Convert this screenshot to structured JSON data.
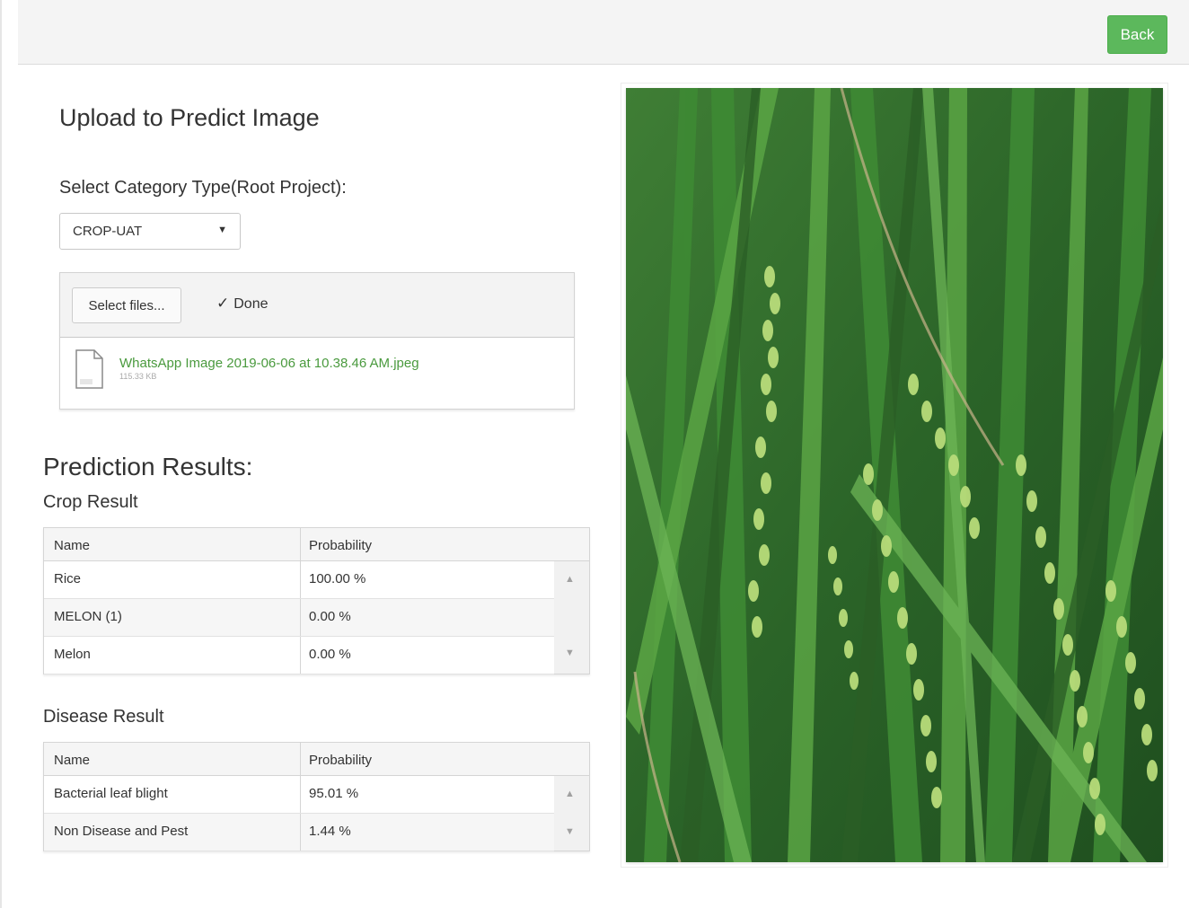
{
  "topbar": {
    "back_label": "Back"
  },
  "upload": {
    "title": "Upload to Predict Image",
    "category_label": "Select Category Type(Root Project):",
    "category_selected": "CROP-UAT",
    "select_files_label": "Select files...",
    "status_label": "Done",
    "file": {
      "name": "WhatsApp Image 2019-06-06 at 10.38.46 AM.jpeg",
      "size": "115.33 KB"
    }
  },
  "results": {
    "title": "Prediction Results:",
    "crop": {
      "title": "Crop Result",
      "columns": [
        "Name",
        "Probability"
      ],
      "rows": [
        {
          "name": "Rice",
          "probability": "100.00 %"
        },
        {
          "name": "MELON (1)",
          "probability": "0.00 %"
        },
        {
          "name": "Melon",
          "probability": "0.00 %"
        }
      ]
    },
    "disease": {
      "title": "Disease Result",
      "columns": [
        "Name",
        "Probability"
      ],
      "rows": [
        {
          "name": "Bacterial leaf blight",
          "probability": "95.01 %"
        },
        {
          "name": "Non Disease and Pest",
          "probability": "1.44 %"
        }
      ]
    }
  },
  "colors": {
    "accent_green": "#5cb85c",
    "file_link": "#4a9a3e"
  },
  "icons": [
    "file-icon",
    "checkmark-icon",
    "caret-down-icon",
    "scroll-up-icon",
    "scroll-down-icon"
  ]
}
